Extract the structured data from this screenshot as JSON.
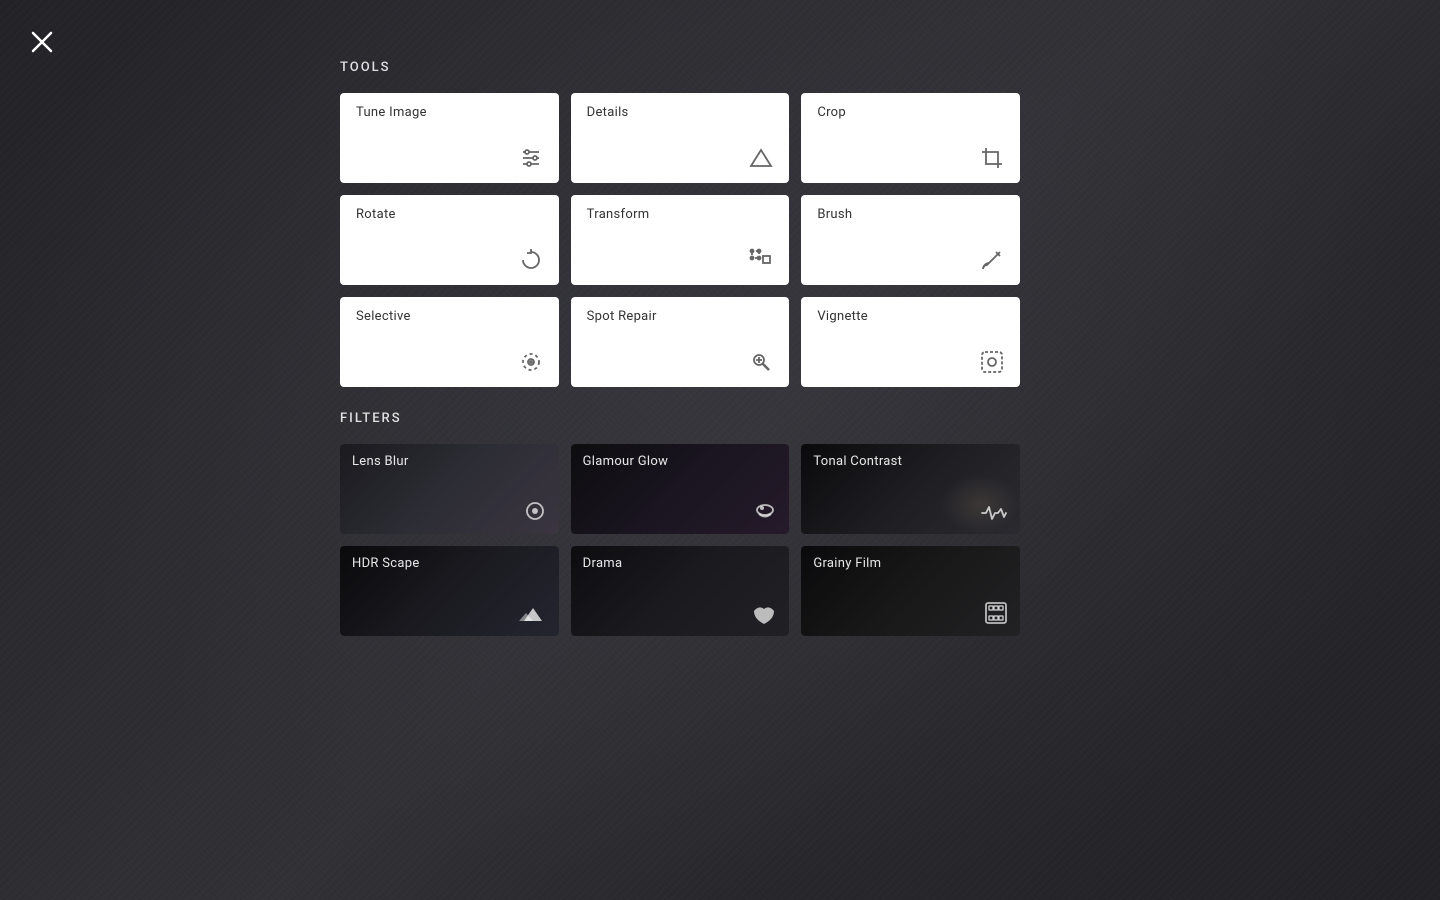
{
  "close_button": "✕",
  "sections": {
    "tools_label": "TOOLS",
    "filters_label": "FILTERS"
  },
  "tools": [
    {
      "id": "tune-image",
      "label": "Tune Image",
      "icon": "sliders"
    },
    {
      "id": "details",
      "label": "Details",
      "icon": "triangle"
    },
    {
      "id": "crop",
      "label": "Crop",
      "icon": "crop"
    },
    {
      "id": "rotate",
      "label": "Rotate",
      "icon": "rotate"
    },
    {
      "id": "transform",
      "label": "Transform",
      "icon": "transform"
    },
    {
      "id": "brush",
      "label": "Brush",
      "icon": "brush"
    },
    {
      "id": "selective",
      "label": "Selective",
      "icon": "selective"
    },
    {
      "id": "spot-repair",
      "label": "Spot Repair",
      "icon": "spotrepair"
    },
    {
      "id": "vignette",
      "label": "Vignette",
      "icon": "vignette"
    }
  ],
  "filters": [
    {
      "id": "lens-blur",
      "label": "Lens Blur",
      "icon": "lensblur",
      "theme": "lens-blur"
    },
    {
      "id": "glamour-glow",
      "label": "Glamour Glow",
      "icon": "glamour",
      "theme": "glamour-glow"
    },
    {
      "id": "tonal-contrast",
      "label": "Tonal Contrast",
      "icon": "tonal",
      "theme": "tonal-contrast"
    },
    {
      "id": "hdr-scape",
      "label": "HDR Scape",
      "icon": "hdr",
      "theme": "hdr-scape"
    },
    {
      "id": "drama",
      "label": "Drama",
      "icon": "drama",
      "theme": "drama"
    },
    {
      "id": "grainy-film",
      "label": "Grainy Film",
      "icon": "grainy",
      "theme": "grainy-film"
    }
  ]
}
